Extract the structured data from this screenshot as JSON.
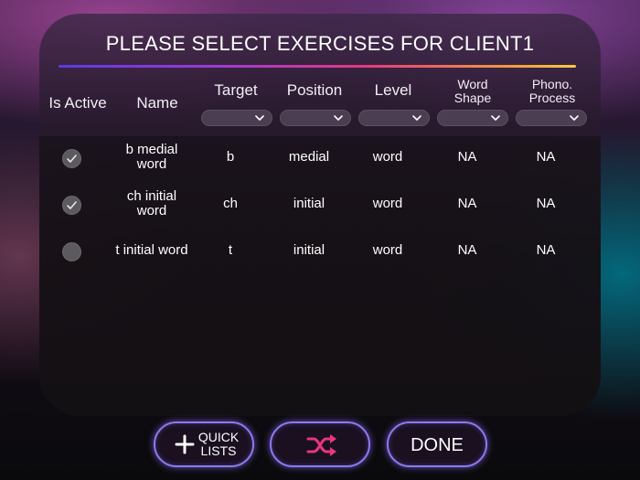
{
  "title": "PLEASE SELECT EXERCISES FOR CLIENT1",
  "columns": {
    "is_active": "Is Active",
    "name": "Name",
    "target": "Target",
    "position": "Position",
    "level": "Level",
    "word_shape": [
      "Word",
      "Shape"
    ],
    "phono_process": [
      "Phono.",
      "Process"
    ]
  },
  "rows": [
    {
      "active": true,
      "name": [
        "b medial",
        "word"
      ],
      "target": "b",
      "position": "medial",
      "level": "word",
      "word_shape": "NA",
      "phono_process": "NA"
    },
    {
      "active": true,
      "name": [
        "ch initial",
        "word"
      ],
      "target": "ch",
      "position": "initial",
      "level": "word",
      "word_shape": "NA",
      "phono_process": "NA"
    },
    {
      "active": false,
      "name": [
        "t initial word"
      ],
      "target": "t",
      "position": "initial",
      "level": "word",
      "word_shape": "NA",
      "phono_process": "NA"
    }
  ],
  "buttons": {
    "quick_lists": [
      "QUICK",
      "LISTS"
    ],
    "done": "DONE"
  },
  "colors": {
    "accent_pink": "#e8357e",
    "button_glow": "#8a7af0",
    "rule_gradient": [
      "#5b3be0",
      "#e83a7e",
      "#f7c94a"
    ]
  }
}
